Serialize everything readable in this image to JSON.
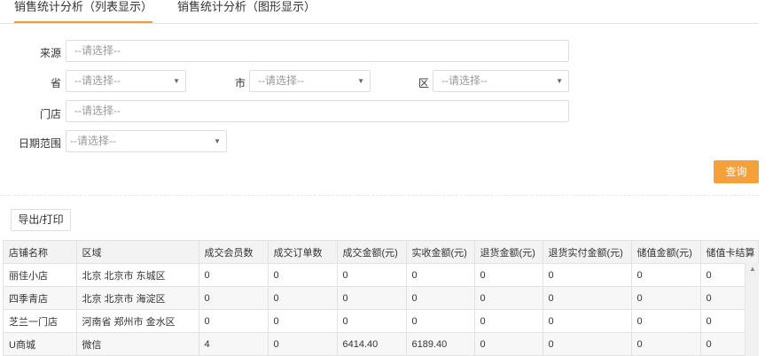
{
  "tabs": [
    {
      "label": "销售统计分析（列表显示）",
      "active": true
    },
    {
      "label": "销售统计分析（图形显示）",
      "active": false
    }
  ],
  "filters": {
    "source_label": "来源",
    "source_placeholder": "--请选择--",
    "province_label": "省",
    "province_placeholder": "--请选择--",
    "city_label": "市",
    "city_placeholder": "--请选择--",
    "district_label": "区",
    "district_placeholder": "--请选择--",
    "store_label": "门店",
    "store_placeholder": "--请选择--",
    "date_label": "日期范围",
    "date_placeholder": "--请选择--"
  },
  "query_label": "查询",
  "export_label": "导出/打印",
  "table": {
    "headers": [
      "店铺名称",
      "区域",
      "成交会员数",
      "成交订单数",
      "成交金额(元)",
      "实收金额(元)",
      "退货金额(元)",
      "退货实付金额(元)",
      "储值金额(元)",
      "储值卡结算"
    ],
    "rows": [
      [
        "丽佳小店",
        "北京 北京市 东城区",
        "0",
        "0",
        "0",
        "0",
        "0",
        "0",
        "0",
        "0"
      ],
      [
        "四季青店",
        "北京 北京市 海淀区",
        "0",
        "0",
        "0",
        "0",
        "0",
        "0",
        "0",
        "0"
      ],
      [
        "芝兰一门店",
        "河南省 郑州市 金水区",
        "0",
        "0",
        "0",
        "0",
        "0",
        "0",
        "0",
        "0"
      ],
      [
        "U商城",
        "微信",
        "4",
        "0",
        "6414.40",
        "6189.40",
        "0",
        "0",
        "0",
        "0"
      ]
    ]
  },
  "colors": {
    "accent": "#f5a13b",
    "tab_underline": "#f39a2b"
  }
}
